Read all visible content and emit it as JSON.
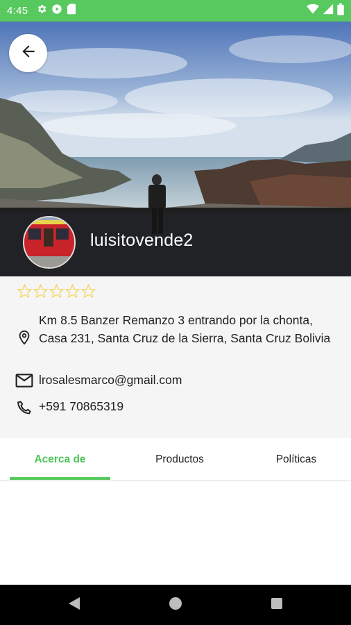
{
  "status_bar": {
    "time": "4:45",
    "icons_left": [
      "gear-icon",
      "play-icon",
      "sd-card-icon"
    ],
    "icons_right": [
      "wifi-icon",
      "signal-icon",
      "battery-icon"
    ]
  },
  "profile": {
    "username": "luisitovende2",
    "rating": {
      "value": 0,
      "max": 5,
      "star_color": "#f3d45b"
    },
    "address": "Km 8.5 Banzer Remanzo 3 entrando por la chonta, Casa 231, Santa Cruz de la Sierra, Santa Cruz Bolivia",
    "email": "lrosalesmarco@gmail.com",
    "phone": "+591 70865319"
  },
  "tabs": [
    {
      "label": "Acerca de",
      "active": true
    },
    {
      "label": "Productos",
      "active": false
    },
    {
      "label": "Políticas",
      "active": false
    }
  ],
  "colors": {
    "accent": "#58c95f",
    "status_bar": "#58c95f",
    "name_band": "#191919"
  }
}
